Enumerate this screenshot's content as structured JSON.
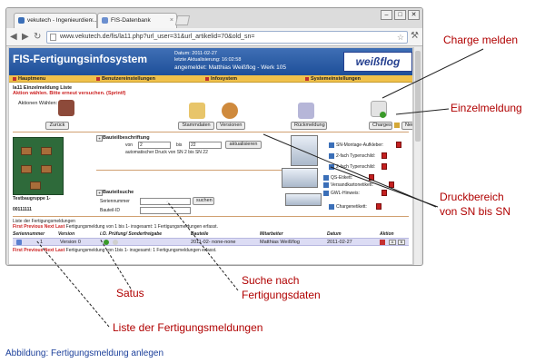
{
  "browser": {
    "tabs": [
      {
        "label": "vekutech - Ingenieurdien..."
      },
      {
        "label": "FIS-Datenbank"
      }
    ],
    "address": "www.vekutech.de/fis/la11.php?url_user=31&url_artikelid=70&old_sn=",
    "window_buttons": {
      "minimize": "–",
      "maximize": "□",
      "close": "✕"
    }
  },
  "app": {
    "title": "FIS-Fertigungsinfosystem",
    "date_line": "Datum: 2011-02-27",
    "update_line": "letzte Aktualisierung: 16:02:58",
    "user_line": "angemeldet: Matthias Weißflog - Werk 105",
    "logo": "weißflog",
    "menu": [
      "Hauptmenu",
      "Benutzereinstellungen",
      "Infosystem",
      "Systemeinstellungen"
    ],
    "breadcrumb": "la11 Einzelmeldung Liste",
    "error_message": "Aktion wählen. Bitte erneut versuchen. (Sprintf)",
    "action_label": "Aktionen Wählen:",
    "buttons": {
      "back": "Zurück",
      "master_data": "Stammdaten",
      "versions": "Versionen",
      "feedback": "Rückmeldung",
      "batch": "Charges",
      "new": "Neu",
      "update": "aktualisieren",
      "search": "suchen"
    },
    "component_group": "Testbaugruppe 1-",
    "part_number": "00111111",
    "label_section": {
      "title": "Bauteilbeschriftung",
      "from_label": "von",
      "from_value": "2",
      "to_label": "bis",
      "to_value": "22",
      "auto_print": "automatischer Druck von SN 2 bis SN 22"
    },
    "search_section": {
      "title": "Bauteilsuche",
      "serial_label": "Seriennummer",
      "part_id_label": "Bauteil-ID",
      "serial_value": "",
      "part_id_value": ""
    },
    "print_items": [
      "SN-Montage-Aufkleber:",
      "2-fach Typenschild:",
      "2-fach Typenschild:",
      "QS-Etikett:",
      "Versandkartonetikett:",
      "GWL-Hinweis:",
      "Chargenetikett:"
    ],
    "list": {
      "title": "Liste der Fertigungsmeldungen",
      "pager_top_nav": "First Previous Next Last",
      "pager_top_info": "Fertigungsmeldung von 1 bis 1- insgesamt: 1 Fertigungsmeldungen erfasst.",
      "pager_bottom_nav": "First Previous Next Last",
      "pager_bottom_info": "Fertigungsmeldung von 1bis 1- insgesamt: 1 Fertigungsmeldungen erfasst.",
      "columns": [
        "Seriennummer",
        "Version",
        "i.O. Prüfung/ Sonderfreigabe",
        "Bauteile",
        "Mitarbeiter",
        "Datum",
        "Aktion"
      ],
      "rows": [
        {
          "serial": "1",
          "version": "Version 0",
          "parts": "2011-02- none-none",
          "employee": "Matthias Weißflog",
          "date": "2011-02-27",
          "action_a": "A",
          "action_b": "B"
        }
      ]
    }
  },
  "annotations": {
    "charge": "Charge melden",
    "single": "Einzelmeldung",
    "print_range_1": "Druckbereich",
    "print_range_2": "von SN bis SN",
    "search_1": "Suche nach",
    "search_2": "Fertigungsdaten",
    "status": "Satus",
    "list": "Liste der Fertigungsmeldungen"
  },
  "caption": "Abbildung: Fertigungsmeldung anlegen",
  "colors": {
    "accent_blue": "#1e4f99",
    "menu_yellow": "#f0c14b",
    "annotation_red": "#b00000",
    "caption_blue": "#1b3f9a"
  }
}
